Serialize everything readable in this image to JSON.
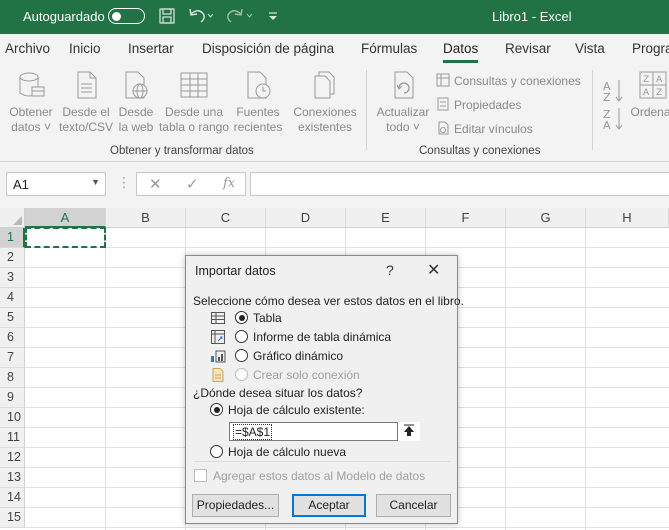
{
  "titlebar": {
    "autosave_label": "Autoguardado",
    "title": "Libro1  -  Excel"
  },
  "tabs": [
    "Archivo",
    "Inicio",
    "Insertar",
    "Disposición de página",
    "Fórmulas",
    "Datos",
    "Revisar",
    "Vista",
    "Progra"
  ],
  "active_tab": "Datos",
  "ribbon": {
    "group1": {
      "label": "Obtener y transformar datos",
      "buttons": [
        {
          "l1": "Obtener",
          "l2": "datos ˅"
        },
        {
          "l1": "Desde el",
          "l2": "texto/CSV"
        },
        {
          "l1": "Desde",
          "l2": "la web"
        },
        {
          "l1": "Desde una",
          "l2": "tabla o rango"
        },
        {
          "l1": "Fuentes",
          "l2": "recientes"
        },
        {
          "l1": "Conexiones",
          "l2": "existentes"
        }
      ]
    },
    "group2": {
      "label": "Consultas y conexiones",
      "refresh": {
        "l1": "Actualizar",
        "l2": "todo ˅"
      },
      "small": [
        "Consultas y conexiones",
        "Propiedades",
        "Editar vínculos"
      ]
    },
    "sort": "Ordenar"
  },
  "formula_bar": {
    "namebox": "A1",
    "fx": "fx",
    "value": ""
  },
  "grid": {
    "columns": [
      "A",
      "B",
      "C",
      "D",
      "E",
      "F",
      "G",
      "H"
    ],
    "rows": [
      "1",
      "2",
      "3",
      "4",
      "5",
      "6",
      "7",
      "8",
      "9",
      "10",
      "11",
      "12",
      "13",
      "14",
      "15"
    ]
  },
  "dialog": {
    "title": "Importar datos",
    "help": "?",
    "close": "✕",
    "prompt1": "Seleccione cómo desea ver estos datos en el libro.",
    "options": [
      {
        "label": "Tabla",
        "selected": true,
        "disabled": false
      },
      {
        "label": "Informe de tabla dinámica",
        "selected": false,
        "disabled": false
      },
      {
        "label": "Gráfico dinámico",
        "selected": false,
        "disabled": false
      },
      {
        "label": "Crear solo conexión",
        "selected": false,
        "disabled": true
      }
    ],
    "prompt2": "¿Dónde desea situar los datos?",
    "place_existing": "Hoja de cálculo existente:",
    "reference": "=$A$1",
    "place_new": "Hoja de cálculo nueva",
    "model_checkbox": "Agregar estos datos al Modelo de datos",
    "buttons": {
      "properties": "Propiedades...",
      "ok": "Aceptar",
      "cancel": "Cancelar"
    }
  }
}
